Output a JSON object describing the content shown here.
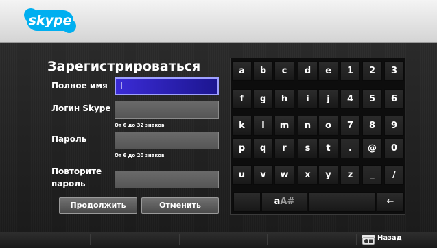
{
  "brand": {
    "logo_text": "skype",
    "brand_color": "#00aff0"
  },
  "form": {
    "title": "Зарегистрироваться",
    "full_name_label": "Полное имя",
    "full_name_value": "I",
    "login_label": "Логин Skype",
    "login_hint": "От 6 до 32 знаков",
    "password_label": "Пароль",
    "password_hint": "От 6 до 20 знаков",
    "repeat_label_line1": "Повторите",
    "repeat_label_line2": "пароль",
    "continue_button": "Продолжить",
    "cancel_button": "Отменить"
  },
  "keyboard": {
    "rows": [
      [
        "a",
        "b",
        "c",
        "d",
        "e",
        "1",
        "2",
        "3"
      ],
      [
        "f",
        "g",
        "h",
        "i",
        "j",
        "4",
        "5",
        "6"
      ],
      [
        "k",
        "l",
        "m",
        "n",
        "o",
        "7",
        "8",
        "9"
      ],
      [
        "p",
        "q",
        "r",
        "s",
        "t",
        ".",
        "@",
        "0"
      ],
      [
        "u",
        "v",
        "w",
        "x",
        "y",
        "z",
        "_",
        "/"
      ]
    ],
    "shift_key_lower": "a",
    "shift_key_upper": "A#",
    "backspace_key": "←"
  },
  "footer": {
    "back_label": "Назад",
    "back_icon": "remote-button-icon"
  }
}
